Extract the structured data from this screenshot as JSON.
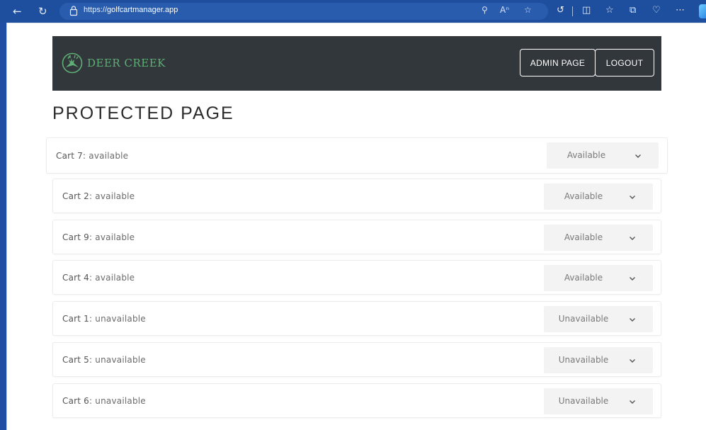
{
  "browser": {
    "url_scheme": "https://",
    "url_host": "golfcartmanager.app"
  },
  "app": {
    "brand_name": "DEER CREEK",
    "admin_button": "ADMIN PAGE",
    "logout_button": "LOGOUT",
    "page_title": "PROTECTED PAGE"
  },
  "carts": [
    {
      "name": "Cart 7",
      "status": "available",
      "selected": "Available"
    },
    {
      "name": "Cart 2",
      "status": "available",
      "selected": "Available"
    },
    {
      "name": "Cart 9",
      "status": "available",
      "selected": "Available"
    },
    {
      "name": "Cart 4",
      "status": "available",
      "selected": "Available"
    },
    {
      "name": "Cart 1",
      "status": "unavailable",
      "selected": "Unavailable"
    },
    {
      "name": "Cart 5",
      "status": "unavailable",
      "selected": "Unavailable"
    },
    {
      "name": "Cart 6",
      "status": "unavailable",
      "selected": "Unavailable"
    }
  ],
  "colors": {
    "nav_background": "#32373b",
    "brand_green": "#5fae75",
    "browser_blue": "#1d4f9e"
  },
  "icons": {
    "back": "back-arrow-icon",
    "reload": "reload-icon",
    "lock": "lock-icon",
    "dropdown": "chevron-down-icon"
  }
}
